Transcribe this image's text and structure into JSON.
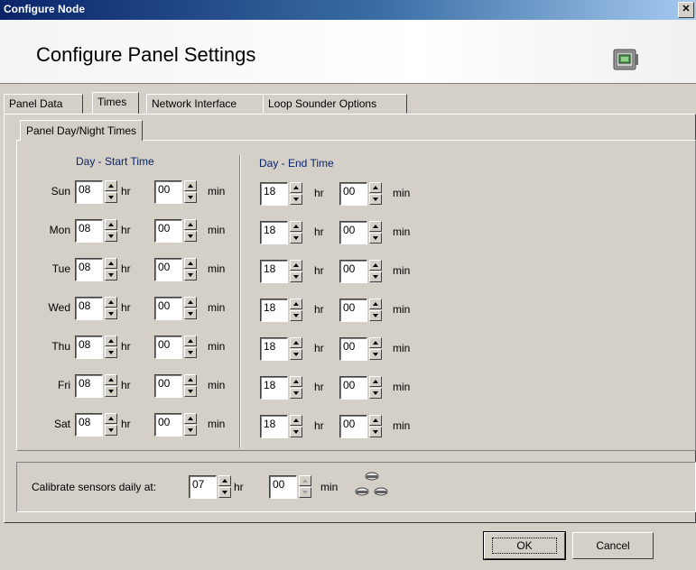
{
  "window": {
    "title": "Configure Node",
    "close_glyph": "✕"
  },
  "header": {
    "title": "Configure Panel Settings",
    "icon": "panel-device-icon"
  },
  "tabs": [
    {
      "label": "Panel Data",
      "active": false
    },
    {
      "label": "Times",
      "active": true
    },
    {
      "label": "Network Interface",
      "active": false
    },
    {
      "label": "Loop Sounder Options",
      "active": false
    }
  ],
  "subtab": {
    "label": "Panel Day/Night Times"
  },
  "start_section": {
    "title": "Day - Start Time"
  },
  "end_section": {
    "title": "Day - End Time"
  },
  "units": {
    "hr": "hr",
    "min": "min"
  },
  "days": [
    {
      "label": "Sun",
      "start_hr": "08",
      "start_min": "00",
      "end_hr": "18",
      "end_min": "00"
    },
    {
      "label": "Mon",
      "start_hr": "08",
      "start_min": "00",
      "end_hr": "18",
      "end_min": "00"
    },
    {
      "label": "Tue",
      "start_hr": "08",
      "start_min": "00",
      "end_hr": "18",
      "end_min": "00"
    },
    {
      "label": "Wed",
      "start_hr": "08",
      "start_min": "00",
      "end_hr": "18",
      "end_min": "00"
    },
    {
      "label": "Thu",
      "start_hr": "08",
      "start_min": "00",
      "end_hr": "18",
      "end_min": "00"
    },
    {
      "label": "Fri",
      "start_hr": "08",
      "start_min": "00",
      "end_hr": "18",
      "end_min": "00"
    },
    {
      "label": "Sat",
      "start_hr": "08",
      "start_min": "00",
      "end_hr": "18",
      "end_min": "00"
    }
  ],
  "calibrate": {
    "label": "Calibrate sensors daily at:",
    "hr": "07",
    "min": "00",
    "hr_unit": "hr",
    "min_unit": "min",
    "icon": "smoke-sensors-icon"
  },
  "buttons": {
    "ok": "OK",
    "cancel": "Cancel"
  }
}
